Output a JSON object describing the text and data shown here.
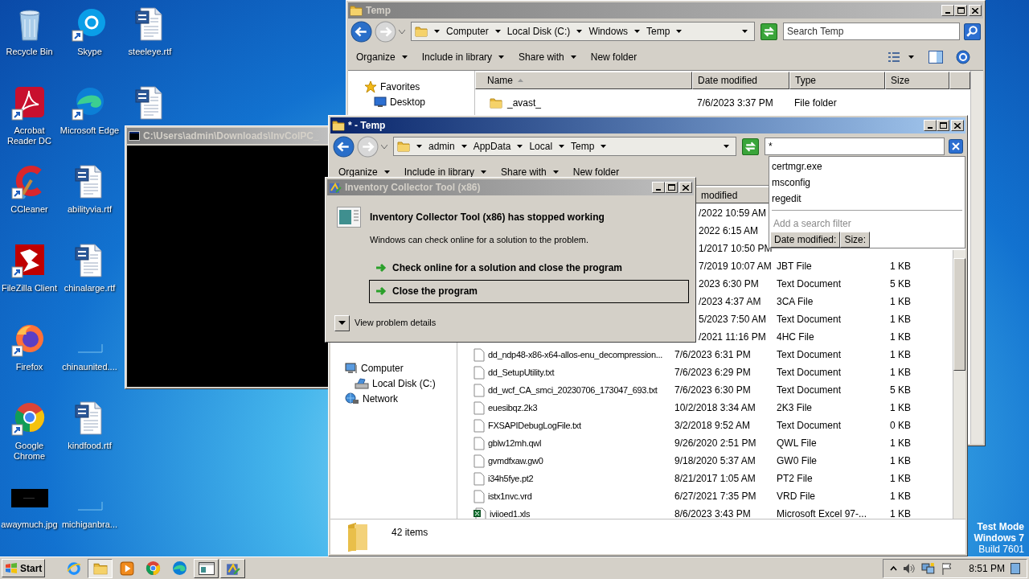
{
  "desktop_icons": [
    {
      "label": "Recycle Bin",
      "kind": "recycle",
      "shortcut": false
    },
    {
      "label": "Acrobat Reader DC",
      "kind": "acrobat",
      "shortcut": true
    },
    {
      "label": "CCleaner",
      "kind": "ccleaner",
      "shortcut": true
    },
    {
      "label": "FileZilla Client",
      "kind": "filezilla",
      "shortcut": true
    },
    {
      "label": "Firefox",
      "kind": "firefox",
      "shortcut": true
    },
    {
      "label": "Google Chrome",
      "kind": "chrome",
      "shortcut": true
    },
    {
      "label": "awaymuch.jpg",
      "kind": "image",
      "shortcut": false
    },
    {
      "label": "Skype",
      "kind": "skype",
      "shortcut": true
    },
    {
      "label": "Microsoft Edge",
      "kind": "edge",
      "shortcut": true
    },
    {
      "label": "abilityvia.rtf",
      "kind": "word",
      "shortcut": false
    },
    {
      "label": "chinalarge.rtf",
      "kind": "word",
      "shortcut": false
    },
    {
      "label": "chinaunited....",
      "kind": "blank",
      "shortcut": false
    },
    {
      "label": "kindfood.rtf",
      "kind": "word",
      "shortcut": false
    },
    {
      "label": "michiganbra...",
      "kind": "blank",
      "shortcut": false
    },
    {
      "label": "steeleye.rtf",
      "kind": "word",
      "shortcut": false
    },
    {
      "kind": "word",
      "shortcut": false
    }
  ],
  "console_window": {
    "title": "C:\\Users\\admin\\Downloads\\InvColPC_",
    "active": false
  },
  "back_window": {
    "title": "Temp",
    "active": false,
    "breadcrumb": [
      "Computer",
      "Local Disk (C:)",
      "Windows",
      "Temp"
    ],
    "search": {
      "placeholder": "Search Temp"
    },
    "toolbar": [
      {
        "label": "Organize",
        "menu": true
      },
      {
        "label": "Include in library",
        "menu": true
      },
      {
        "label": "Share with",
        "menu": true
      },
      {
        "label": "New folder",
        "menu": false
      }
    ],
    "nav": [
      {
        "label": "Favorites",
        "kind": "favorites",
        "children": [
          {
            "label": "Desktop",
            "kind": "desktop"
          }
        ]
      }
    ],
    "columns": [
      {
        "label": "Name",
        "sorted": true
      },
      {
        "label": "Date modified",
        "sorted": false
      },
      {
        "label": "Type",
        "sorted": false
      },
      {
        "label": "Size",
        "sorted": false
      }
    ],
    "rows": [
      {
        "name": "_avast_",
        "date": "7/6/2023 3:37 PM",
        "type": "File folder",
        "kind": "folder"
      }
    ]
  },
  "front_window": {
    "title": "* - Temp",
    "active": true,
    "breadcrumb": [
      "admin",
      "AppData",
      "Local",
      "Temp"
    ],
    "search": {
      "value": "*"
    },
    "suggestions": [
      "certmgr.exe",
      "msconfig",
      "regedit"
    ],
    "filter_hint": "Add a search filter",
    "filters": [
      "Date modified:",
      "Size:"
    ],
    "toolbar": [
      {
        "label": "Organize",
        "menu": true
      },
      {
        "label": "Include in library",
        "menu": true
      },
      {
        "label": "Share with",
        "menu": true
      },
      {
        "label": "New folder",
        "menu": false
      }
    ],
    "date_header": "modified",
    "rows": [
      {
        "date": "/2022 10:59 AM"
      },
      {
        "date": "2022 6:15 AM"
      },
      {
        "date": "1/2017 10:50 PM"
      },
      {
        "date": "7/2019 10:07 AM",
        "type": "JBT File",
        "size": "1 KB"
      },
      {
        "date": "2023 6:30 PM",
        "type": "Text Document",
        "size": "5 KB"
      },
      {
        "date": "/2023 4:37 AM",
        "type": "3CA File",
        "size": "1 KB"
      },
      {
        "date": "5/2023 7:50 AM",
        "type": "Text Document",
        "size": "1 KB"
      },
      {
        "date": "/2021 11:16 PM",
        "type": "4HC File",
        "size": "1 KB"
      },
      {
        "name": "dd_ndp48-x86-x64-allos-enu_decompression...",
        "date": "7/6/2023 6:31 PM",
        "type": "Text Document",
        "size": "1 KB",
        "kind": "file"
      },
      {
        "name": "dd_SetupUtility.txt",
        "date": "7/6/2023 6:29 PM",
        "type": "Text Document",
        "size": "1 KB",
        "kind": "file"
      },
      {
        "name": "dd_wcf_CA_smci_20230706_173047_693.txt",
        "date": "7/6/2023 6:30 PM",
        "type": "Text Document",
        "size": "5 KB",
        "kind": "file"
      },
      {
        "name": "euesibqz.2k3",
        "date": "10/2/2018 3:34 AM",
        "type": "2K3 File",
        "size": "1 KB",
        "kind": "file"
      },
      {
        "name": "FXSAPIDebugLogFile.txt",
        "date": "3/2/2018 9:52 AM",
        "type": "Text Document",
        "size": "0 KB",
        "kind": "file"
      },
      {
        "name": "gblw12mh.qwl",
        "date": "9/26/2020 2:51 PM",
        "type": "QWL File",
        "size": "1 KB",
        "kind": "file"
      },
      {
        "name": "gvmdfxaw.gw0",
        "date": "9/18/2020 5:37 AM",
        "type": "GW0 File",
        "size": "1 KB",
        "kind": "file"
      },
      {
        "name": "i34h5fye.pt2",
        "date": "8/21/2017 1:05 AM",
        "type": "PT2 File",
        "size": "1 KB",
        "kind": "file"
      },
      {
        "name": "istx1nvc.vrd",
        "date": "6/27/2021 7:35 PM",
        "type": "VRD File",
        "size": "1 KB",
        "kind": "file"
      },
      {
        "name": "iviioed1.xls",
        "date": "8/6/2023 3:43 PM",
        "type": "Microsoft Excel 97-...",
        "size": "1 KB",
        "kind": "excel"
      }
    ],
    "nav": [
      {
        "label": "Computer",
        "kind": "computer",
        "children": [
          {
            "label": "Local Disk (C:)",
            "kind": "disk"
          }
        ]
      },
      {
        "label": "Network",
        "kind": "network"
      }
    ],
    "status": "42 items"
  },
  "dialog": {
    "title": "Inventory Collector Tool (x86)",
    "active": false,
    "heading": "Inventory Collector Tool (x86) has stopped working",
    "message": "Windows can check online for a solution to the problem.",
    "options": [
      {
        "label": "Check online for a solution and close the program",
        "selected": false
      },
      {
        "label": "Close the program",
        "selected": true
      }
    ],
    "details_label": "View problem details"
  },
  "os_notice": [
    {
      "text": "Test Mode",
      "bold": true
    },
    {
      "text": "Windows 7",
      "bold": true
    },
    {
      "text": "Build 7601",
      "bold": false
    }
  ],
  "taskbar": {
    "start_label": "Start",
    "apps": [
      {
        "kind": "ie",
        "selected": false,
        "open": false
      },
      {
        "kind": "explorer",
        "selected": true,
        "open": true
      },
      {
        "kind": "media",
        "selected": false,
        "open": false
      },
      {
        "kind": "chrome",
        "selected": false,
        "open": false
      },
      {
        "kind": "edge",
        "selected": false,
        "open": false
      },
      {
        "kind": "window",
        "selected": false,
        "open": true
      },
      {
        "kind": "tool",
        "selected": false,
        "open": true
      }
    ],
    "clock": "8:51 PM"
  }
}
